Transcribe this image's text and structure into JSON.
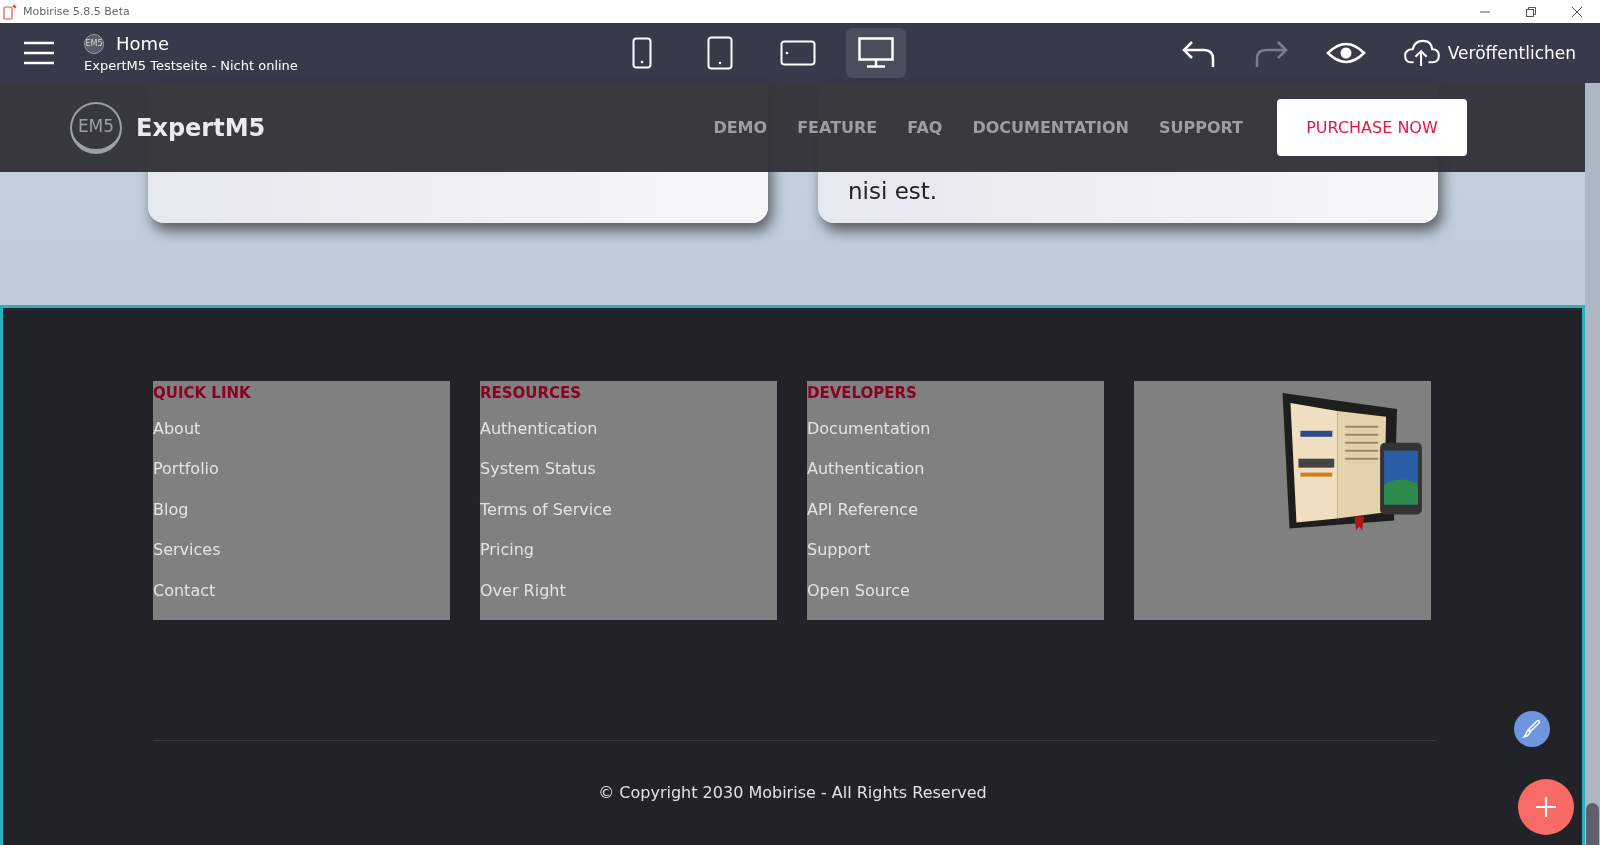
{
  "window": {
    "title": "Mobirise 5.8.5 Beta"
  },
  "toolbar": {
    "logo": "EM5",
    "page_title": "Home",
    "site_status": "ExpertM5 Testseite - Nicht online",
    "devices": [
      {
        "kind": "phone",
        "selected": false
      },
      {
        "kind": "tablet",
        "selected": false
      },
      {
        "kind": "landscape",
        "selected": false
      },
      {
        "kind": "desktop",
        "selected": true
      }
    ],
    "redo_disabled": true,
    "publish": "Veröffentlichen"
  },
  "cards": [
    {
      "kind": "empty"
    },
    {
      "kind": "text",
      "lines": [
        "nisi est."
      ]
    }
  ],
  "navbar": {
    "brand": "ExpertM5",
    "logo": "EM5",
    "links": [
      "DEMO",
      "FEATURE",
      "FAQ",
      "DOCUMENTATION",
      "SUPPORT"
    ],
    "cta": "PURCHASE NOW"
  },
  "footer": {
    "columns": [
      {
        "heading": "QUICK LINK",
        "links": [
          "About",
          "Portfolio",
          "Blog",
          "Services",
          "Contact"
        ]
      },
      {
        "heading": "RESOURCES",
        "links": [
          "Authentication",
          "System Status",
          "Terms of Service",
          "Pricing",
          "Over Right"
        ]
      },
      {
        "heading": "DEVELOPERS",
        "links": [
          "Documentation",
          "Authentication",
          "API Reference",
          "Support",
          "Open Source"
        ]
      },
      {
        "kind": "picture"
      }
    ],
    "copyright": "© Copyright 2030 Mobirise - All Rights Reserved"
  }
}
